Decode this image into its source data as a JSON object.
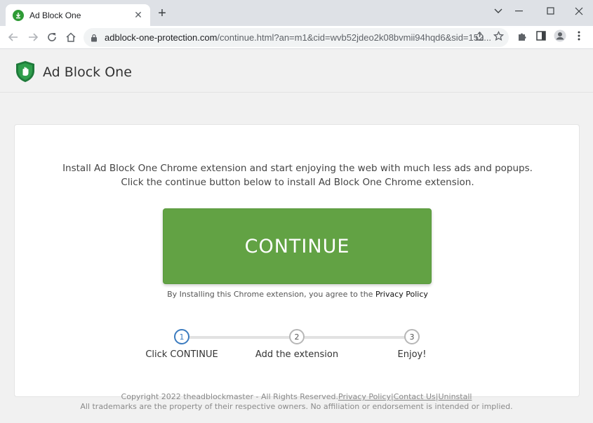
{
  "browser": {
    "tab_title": "Ad Block One",
    "url_host": "adblock-one-protection.com",
    "url_rest": "/continue.html?an=m1&cid=wvb52jdeo2k08bvmii94hqd6&sid=152..."
  },
  "header": {
    "brand": "Ad Block One"
  },
  "main": {
    "intro": "Install Ad Block One Chrome extension and start enjoying the web with much less ads and popups. Click the continue button below to install Ad Block One Chrome extension.",
    "cta_label": "CONTINUE",
    "agree_text": "By Installing this Chrome extension, you agree to the ",
    "agree_link": "Privacy Policy"
  },
  "steps": [
    {
      "number": "1",
      "label": "Click CONTINUE",
      "active": true
    },
    {
      "number": "2",
      "label": "Add the extension",
      "active": false
    },
    {
      "number": "3",
      "label": "Enjoy!",
      "active": false
    }
  ],
  "footer": {
    "copyright": "Copyright 2022 theadblockmaster - All Rights Reserved.",
    "link_privacy": "Privacy Policy",
    "separator": "|",
    "link_contact": "Contact Us",
    "link_uninstall": "Uninstall",
    "disclaimer": "All trademarks are the property of their respective owners. No affiliation or endorsement is intended or implied."
  },
  "colors": {
    "cta_green": "#62a244",
    "active_step_blue": "#3b7bbf",
    "brand_shield_green": "#1e7a3a"
  }
}
